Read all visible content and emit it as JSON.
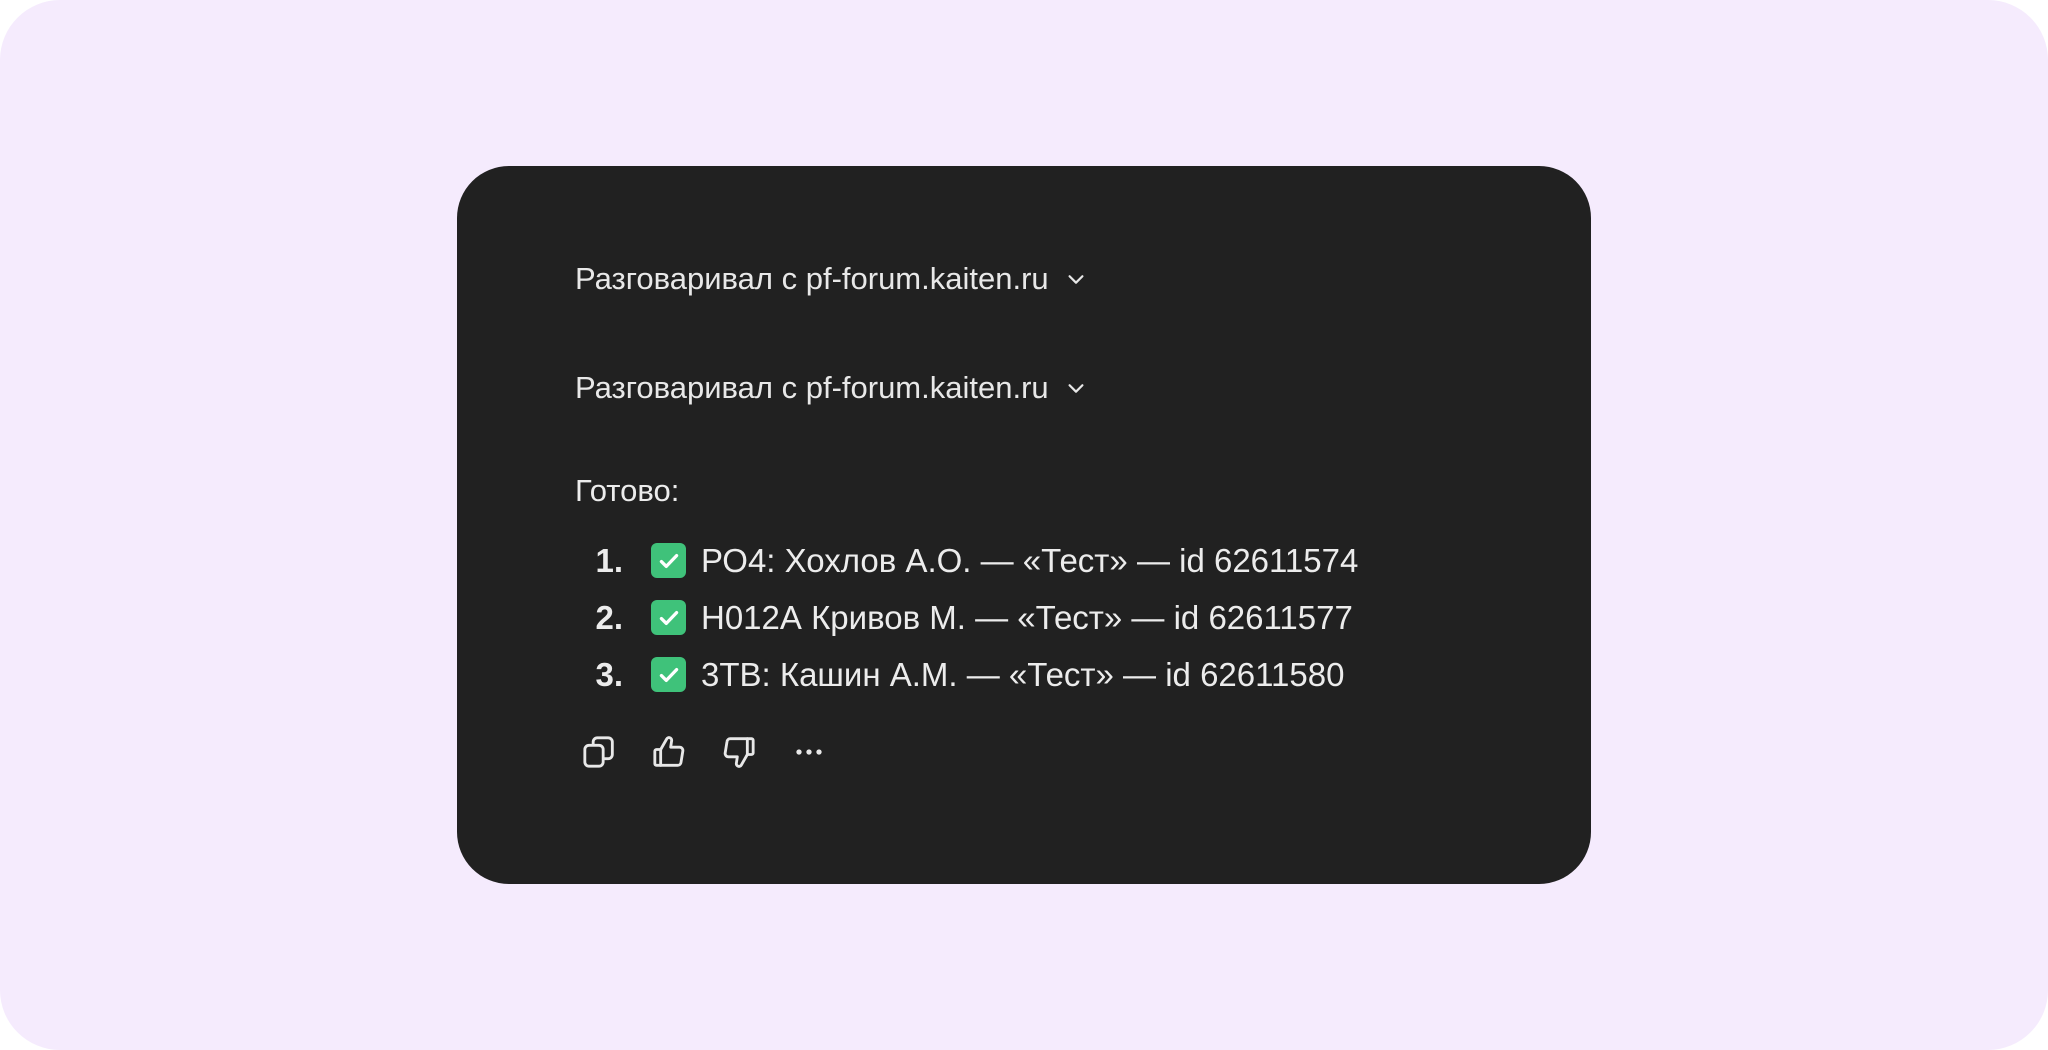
{
  "conversation": {
    "disclosures": [
      {
        "label": "Разговаривал с pf-forum.kaiten.ru",
        "icon": "chevron-down-icon"
      },
      {
        "label": "Разговаривал с pf-forum.kaiten.ru",
        "icon": "chevron-down-icon"
      }
    ],
    "result_title": "Готово:",
    "items": [
      {
        "number": "1.",
        "text": "РО4: Хохлов А.О. — «Тест» — id 62611574",
        "icon": "check-mark-icon"
      },
      {
        "number": "2.",
        "text": "Н012А Кривов М. — «Тест» — id 62611577",
        "icon": "check-mark-icon"
      },
      {
        "number": "3.",
        "text": "3ТВ: Кашин А.М. — «Тест» — id 62611580",
        "icon": "check-mark-icon"
      }
    ],
    "actions": [
      "copy-icon",
      "thumbs-up-icon",
      "thumbs-down-icon",
      "more-icon"
    ]
  },
  "colors": {
    "page_background": "#f5ebfd",
    "card_background": "#212121",
    "text": "#ececec",
    "check_green": "#3fc27a"
  }
}
